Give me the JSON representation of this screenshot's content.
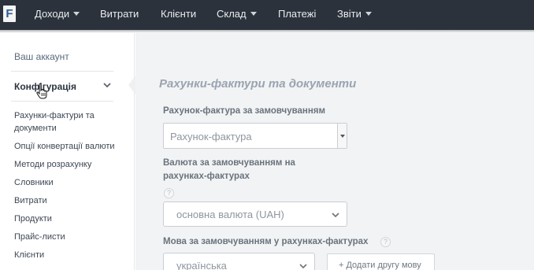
{
  "header": {
    "logo_letter": "F",
    "menu": [
      {
        "label": "Доходи",
        "dropdown": true
      },
      {
        "label": "Витрати",
        "dropdown": false
      },
      {
        "label": "Клієнти",
        "dropdown": false
      },
      {
        "label": "Склад",
        "dropdown": true
      },
      {
        "label": "Платежі",
        "dropdown": false
      },
      {
        "label": "Звіти",
        "dropdown": true
      }
    ]
  },
  "sidebar": {
    "account": "Ваш аккаунт",
    "configuration": "Конфігурація",
    "items": [
      "Рахунки-фактури та документи",
      "Опції конвертації валюти",
      "Методи розрахунку",
      "Словники",
      "Витрати",
      "Продукти",
      "Прайс-листи",
      "Клієнти"
    ]
  },
  "main": {
    "title": "Рахунки-фактури та документи",
    "default_invoice": {
      "label": "Рахунок-фактура за замовчуванням",
      "value": "Рахунок-фактура"
    },
    "default_currency": {
      "label_line1": "Валюта за замовчуванням на",
      "label_line2": "рахунках-фактурах",
      "help": "?",
      "value": "основна валюта (UAH)"
    },
    "default_language": {
      "label": "Мова за замовчуванням у рахунках-фактурах",
      "help": "?",
      "value": "українська",
      "add_second_language": "+ Додати другу мову"
    }
  },
  "colors": {
    "nav_bg": "#2b323b",
    "main_bg": "#f1f3f5",
    "title_color": "#9aa4af"
  }
}
